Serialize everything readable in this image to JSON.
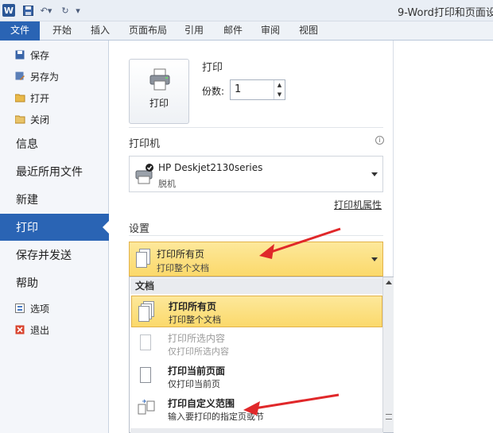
{
  "titlebar": {
    "app_icon": "W",
    "title": "9-Word打印和页面设"
  },
  "ribbon": {
    "tabs": [
      "文件",
      "开始",
      "插入",
      "页面布局",
      "引用",
      "邮件",
      "审阅",
      "视图"
    ]
  },
  "nav": {
    "save": "保存",
    "save_as": "另存为",
    "open": "打开",
    "close": "关闭",
    "info": "信息",
    "recent": "最近所用文件",
    "new": "新建",
    "print": "打印",
    "save_send": "保存并发送",
    "help": "帮助",
    "options": "选项",
    "exit": "退出"
  },
  "print": {
    "header": "打印",
    "button_label": "打印",
    "copies_label": "份数:",
    "copies_value": "1"
  },
  "printer": {
    "header": "打印机",
    "name": "HP Deskjet2130series",
    "status": "脱机",
    "properties_link": "打印机属性"
  },
  "settings": {
    "header": "设置",
    "selected_title": "打印所有页",
    "selected_desc": "打印整个文档",
    "section_label": "文档",
    "options": [
      {
        "title": "打印所有页",
        "desc": "打印整个文档"
      },
      {
        "title": "打印所选内容",
        "desc": "仅打印所选内容"
      },
      {
        "title": "打印当前页面",
        "desc": "仅打印当前页"
      },
      {
        "title": "打印自定义范围",
        "desc": "输入要打印的指定页或节"
      }
    ]
  },
  "colors": {
    "accent": "#2a64b4",
    "highlight": "#fbd96b",
    "annotation_arrow": "#e0282a"
  }
}
